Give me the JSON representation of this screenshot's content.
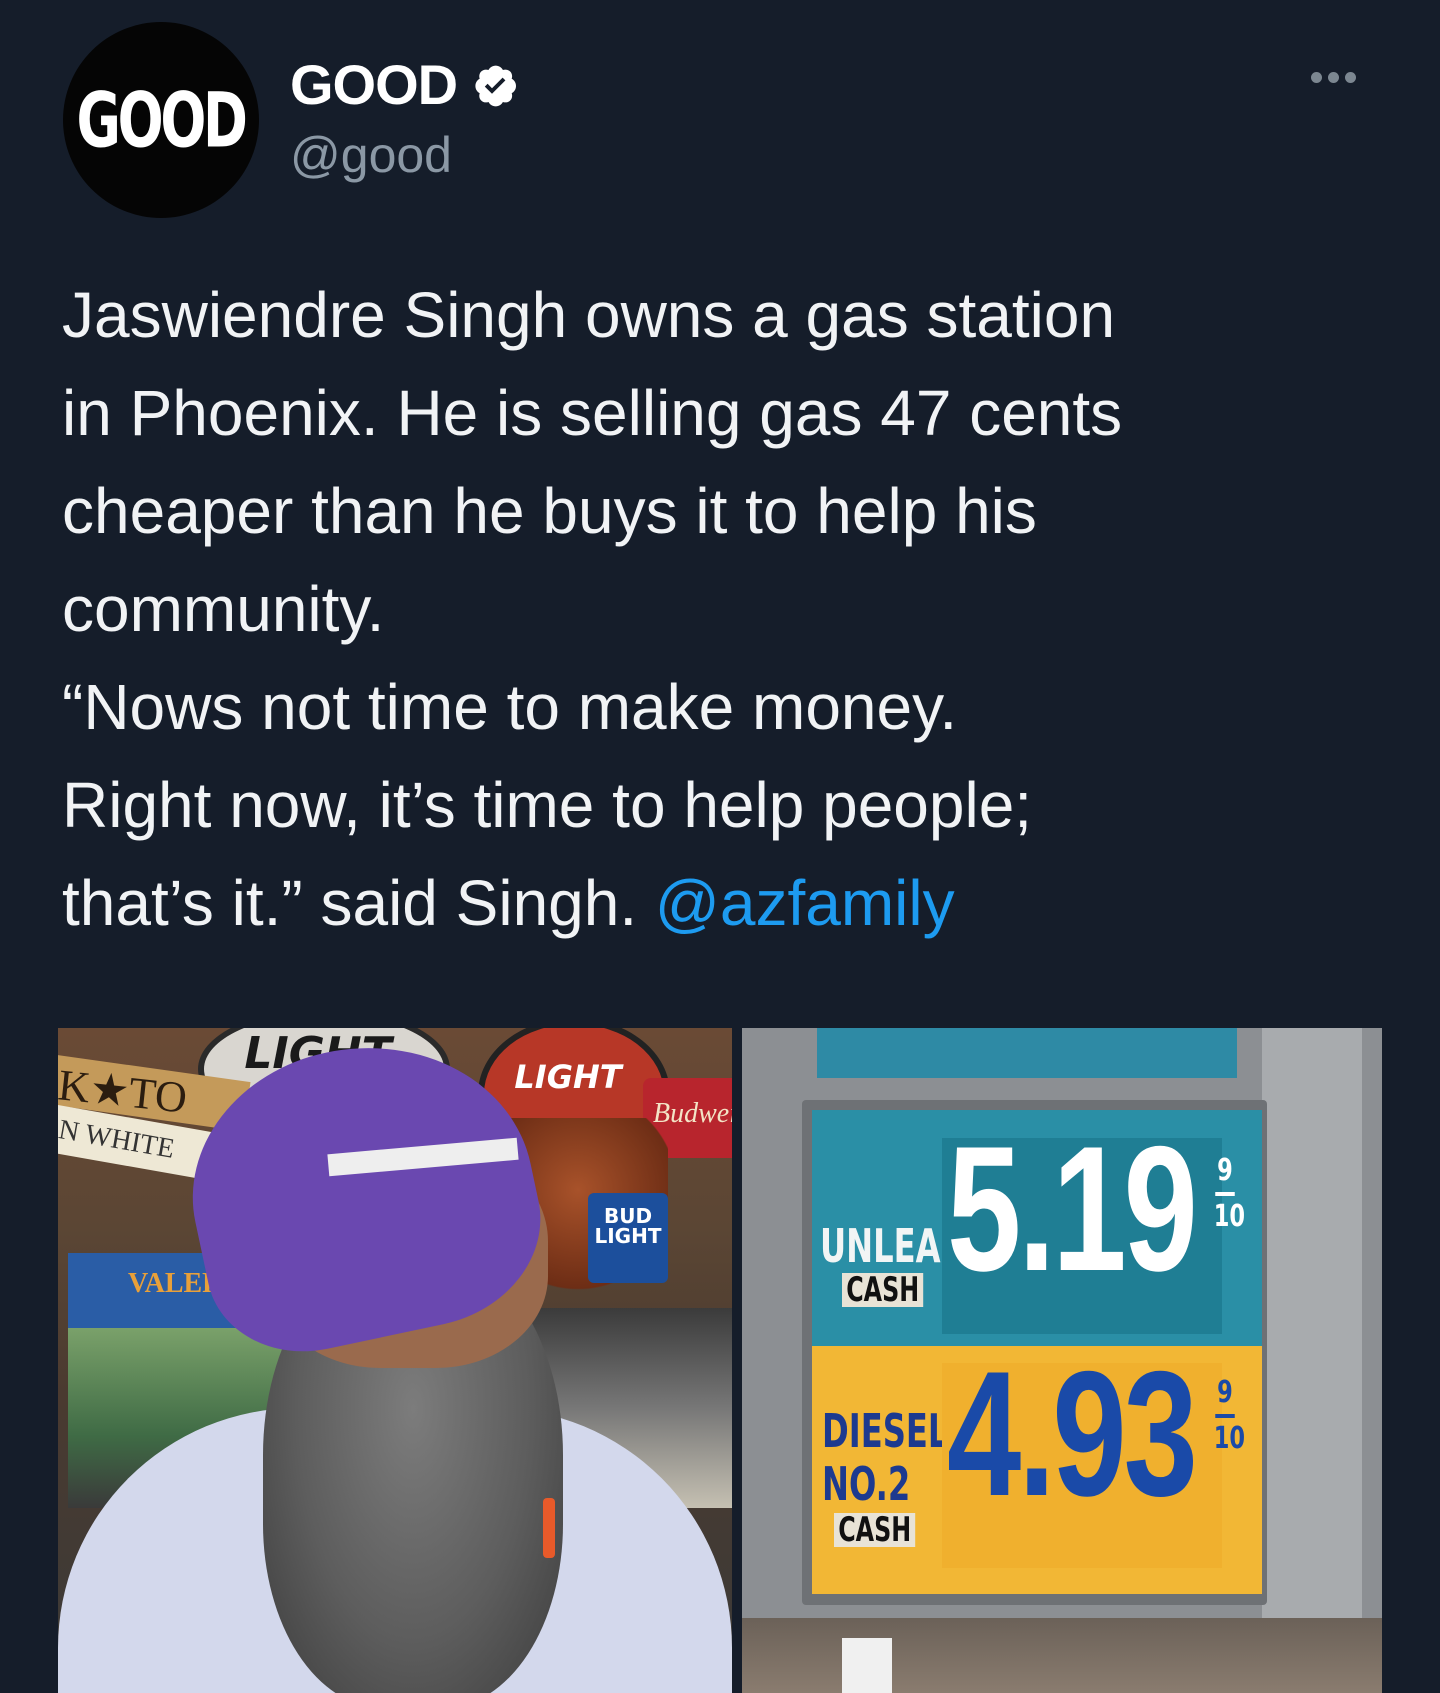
{
  "account": {
    "avatar_text": "GOOD",
    "display_name": "GOOD",
    "handle": "@good",
    "verified": true,
    "verified_icon": "verified-badge-icon",
    "more_icon": "more-options-icon"
  },
  "tweet": {
    "paragraph_1": "Jaswiendre Singh owns a gas station\nin Phoenix. He is selling gas 47 cents\ncheaper than he buys it to help his\ncommunity.",
    "paragraph_2": "“Nows not time to make money.\nRight now, it’s time to help people;\nthat’s it.” said Singh. ",
    "mention": "@azfamily",
    "mention_color": "#1d9bf0"
  },
  "media_left": {
    "sign_1": "LIGHT",
    "sign_2": "LIGHT",
    "banner": "K★TO",
    "white_sign": "N WHITE",
    "beer_sign": "Budwei",
    "bud_light": "BUD\nLIGHT",
    "valero": "VALERO"
  },
  "media_right": {
    "unlead_label": "UNLEAD",
    "unlead_cash": "CASH",
    "unlead_price": "5.19",
    "unlead_frac_top": "9",
    "unlead_frac_bottom": "10",
    "diesel_label": "DIESEL",
    "diesel_no": "NO.2",
    "diesel_cash": "CASH",
    "diesel_price": "4.93",
    "diesel_frac_top": "9",
    "diesel_frac_bottom": "10"
  },
  "colors": {
    "background": "#151d2a",
    "text": "#f1f3f5",
    "muted": "#8b98a5",
    "accent": "#1d9bf0"
  }
}
